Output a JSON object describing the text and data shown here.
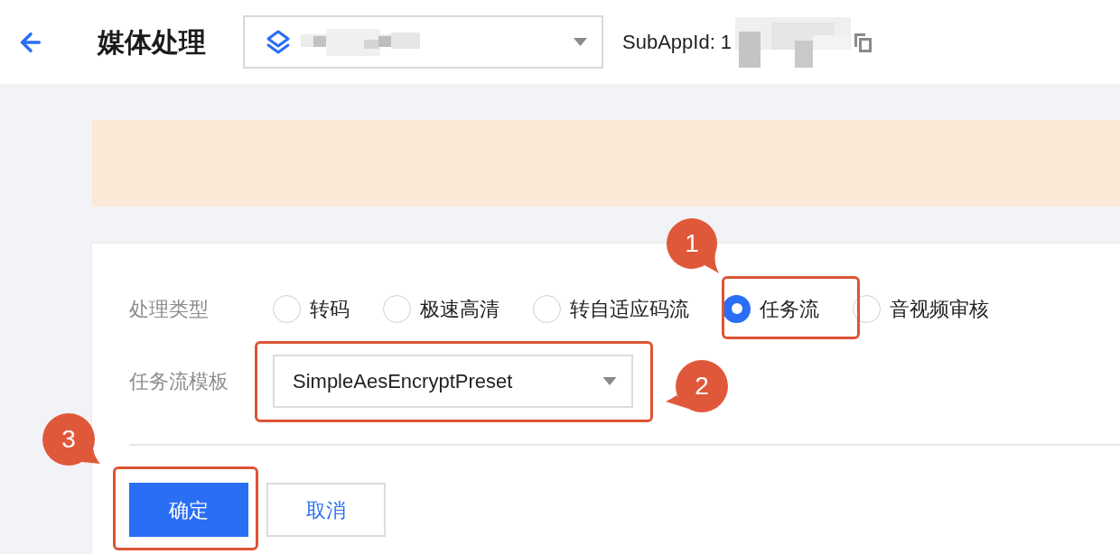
{
  "header": {
    "title": "媒体处理",
    "sub_app_id_label": "SubAppId: 1"
  },
  "form": {
    "fields": [
      {
        "kind": "radio",
        "label": "处理类型",
        "options": [
          {
            "label": "转码",
            "selected": false
          },
          {
            "label": "极速高清",
            "selected": false
          },
          {
            "label": "转自适应码流",
            "selected": false
          },
          {
            "label": "任务流",
            "selected": true
          },
          {
            "label": "音视频审核",
            "selected": false
          }
        ]
      },
      {
        "kind": "select",
        "label": "任务流模板",
        "value": "SimpleAesEncryptPreset"
      }
    ],
    "buttons": [
      {
        "label": "确定",
        "kind": "primary"
      },
      {
        "label": "取消",
        "kind": "secondary"
      }
    ]
  },
  "annotations": [
    {
      "number": "1"
    },
    {
      "number": "2"
    },
    {
      "number": "3"
    }
  ]
}
